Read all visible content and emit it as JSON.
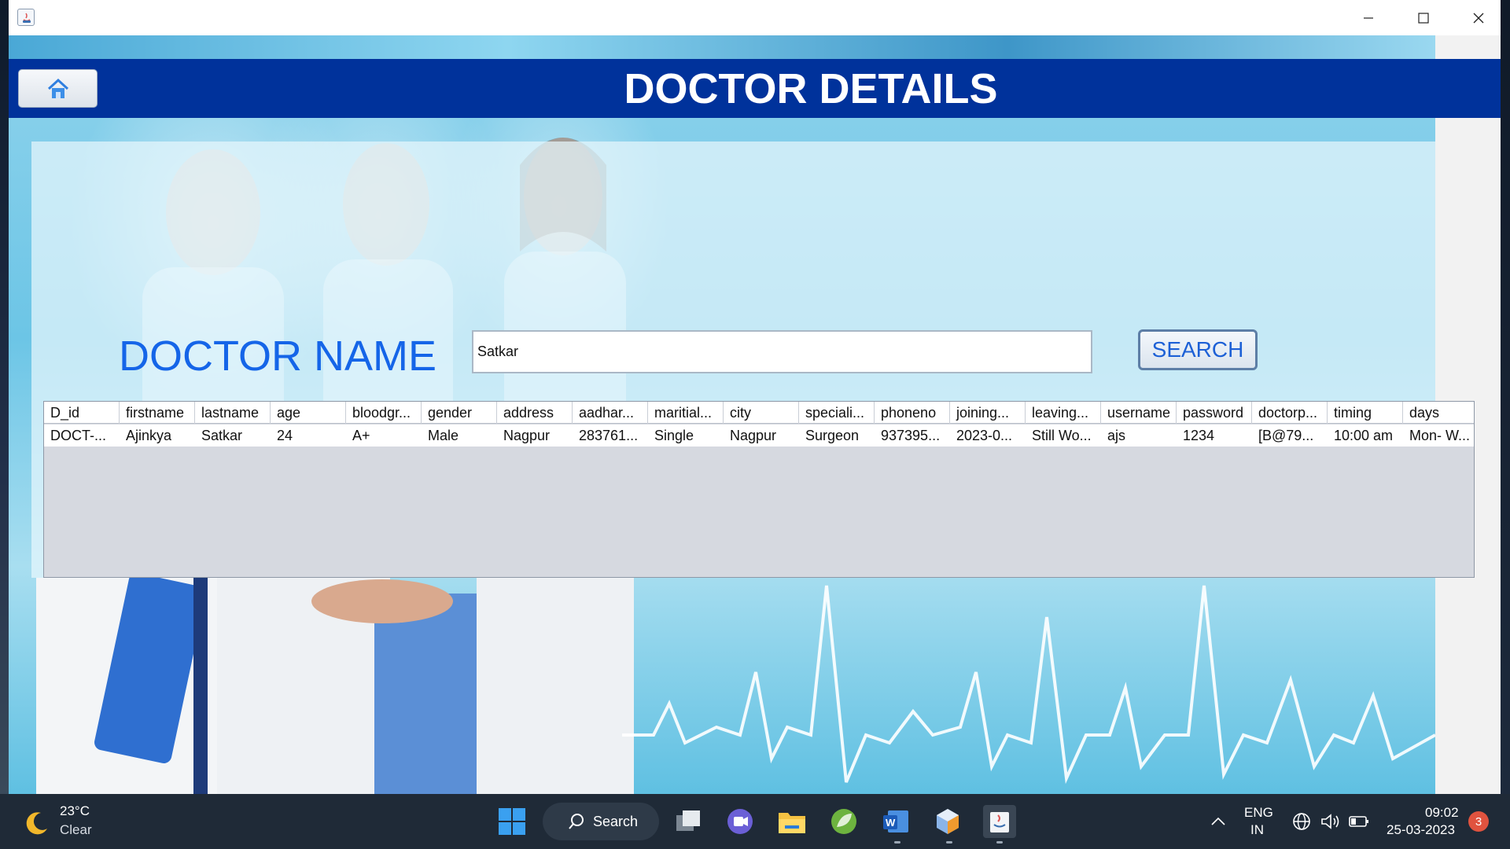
{
  "window": {
    "controls": {
      "minimize": "minimize-icon",
      "maximize": "maximize-icon",
      "close": "close-icon"
    }
  },
  "header": {
    "title": "DOCTOR DETAILS",
    "home_icon": "home-icon"
  },
  "search": {
    "label": "DOCTOR NAME",
    "value": "Satkar",
    "button_label": "SEARCH"
  },
  "table": {
    "columns": [
      "D_id",
      "firstname",
      "lastname",
      "age",
      "bloodgr...",
      "gender",
      "address",
      "aadhar...",
      "maritial...",
      "city",
      "speciali...",
      "phoneno",
      "joining...",
      "leaving...",
      "username",
      "password",
      "doctorp...",
      "timing",
      "days"
    ],
    "rows": [
      [
        "DOCT-...",
        "Ajinkya",
        "Satkar",
        "24",
        "A+",
        "Male",
        "Nagpur",
        "283761...",
        "Single",
        "Nagpur",
        "Surgeon",
        "937395...",
        "2023-0...",
        "Still Wo...",
        "ajs",
        "1234",
        "[B@79...",
        "10:00 am",
        "Mon- W..."
      ]
    ]
  },
  "taskbar": {
    "weather": {
      "temp": "23°C",
      "condition": "Clear"
    },
    "search_label": "Search",
    "language": {
      "line1": "ENG",
      "line2": "IN"
    },
    "clock": {
      "time": "09:02",
      "date": "25-03-2023"
    },
    "notification_count": "3"
  },
  "colors": {
    "header_bar": "#00329b",
    "label_blue": "#1565e8",
    "taskbar": "#1f2a37"
  }
}
